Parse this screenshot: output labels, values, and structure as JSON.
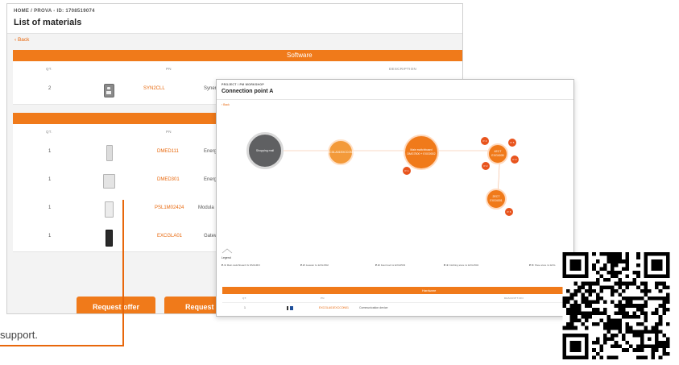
{
  "list_window": {
    "breadcrumb": "HOME / PROVA - ID: 1708519074",
    "title": "List of materials",
    "back": "‹ Back",
    "software": {
      "header": "Software",
      "columns": {
        "qt": "QT.",
        "pn": "PN",
        "description": "DESCRIPTION"
      },
      "rows": [
        {
          "qt": "2",
          "pn": "SYN2CLL",
          "description": "Synergy",
          "icon": "phone-device-icon"
        }
      ]
    },
    "hardware": {
      "columns": {
        "qt": "QT.",
        "pn": "PN"
      },
      "rows": [
        {
          "qt": "1",
          "pn": "DMED111",
          "description": "Energy m",
          "icon": "din-meter-slim-icon"
        },
        {
          "qt": "1",
          "pn": "DMED301",
          "description": "Energy m",
          "icon": "din-meter-wide-icon"
        },
        {
          "qt": "1",
          "pn": "PSL1M02424",
          "description": "Modula",
          "icon": "power-supply-icon"
        },
        {
          "qt": "1",
          "pn": "EXCGLA01",
          "description": "Gatewa",
          "icon": "gateway-icon"
        }
      ]
    },
    "buttons": {
      "request_offer": "Request offer",
      "request_tech": "Request te"
    }
  },
  "caption": {
    "text": "support."
  },
  "conn_window": {
    "breadcrumb": "PROJECT / PM WORKSHOP",
    "title": "Connection point A",
    "back": "‹ Back",
    "nodes": {
      "mall": "Shopping mall",
      "gateway": "EXCGLA01EXCCON01",
      "main_line1": "Main switchboard",
      "main_line2": "DMG7500 + EXG0002",
      "ect_line1": "4ECT",
      "ect_line2": "EXG4005",
      "ect2_line1": "2ECT",
      "ect2_line2": "EXG4001"
    },
    "badges": {
      "b1": "P. 1",
      "b2": "P. 4",
      "b3": "P. 5",
      "b4": "P. 2",
      "b5": "P. 3",
      "b6": "P. 6"
    },
    "legend": {
      "label": "Legend",
      "items": [
        {
          "key": "P. 1:",
          "text": " Main switchboard 3x DM11M/0"
        },
        {
          "key": "P. 2:",
          "text": " Jeweler 1x EXG1502"
        },
        {
          "key": "P. 3:",
          "text": " Fast food 1x EXG0503"
        },
        {
          "key": "P. 4:",
          "text": " Clothing store 1x EXG1502"
        },
        {
          "key": "P. 5:",
          "text": " Shoe store 1x EXG"
        }
      ]
    },
    "hardware": {
      "header": "Hardware",
      "columns": {
        "qt": "QT.",
        "pn": "PN",
        "description": "DESCRIPTION"
      },
      "row": {
        "qt": "1",
        "pn": "EXCGLA01EXCCON01",
        "description": "Communication device"
      }
    }
  },
  "colors": {
    "accent": "#f07a1a",
    "accent_dark": "#e8541d",
    "node_gray": "#5f6062"
  }
}
